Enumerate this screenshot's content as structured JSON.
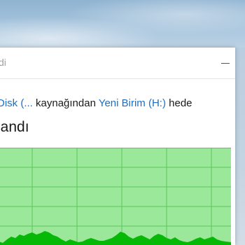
{
  "window": {
    "title_partial": "di"
  },
  "status": {
    "source_label": "Disk (...",
    "from_text": " kaynağından ",
    "dest_label": "Yeni Birim (H:)",
    "to_text": " hede"
  },
  "progress": {
    "heading_partial": "landı"
  },
  "colors": {
    "link": "#1a6fc9",
    "graph_fill": "#9be89b",
    "graph_area": "#06b906",
    "grid": "#5cc45c"
  }
}
